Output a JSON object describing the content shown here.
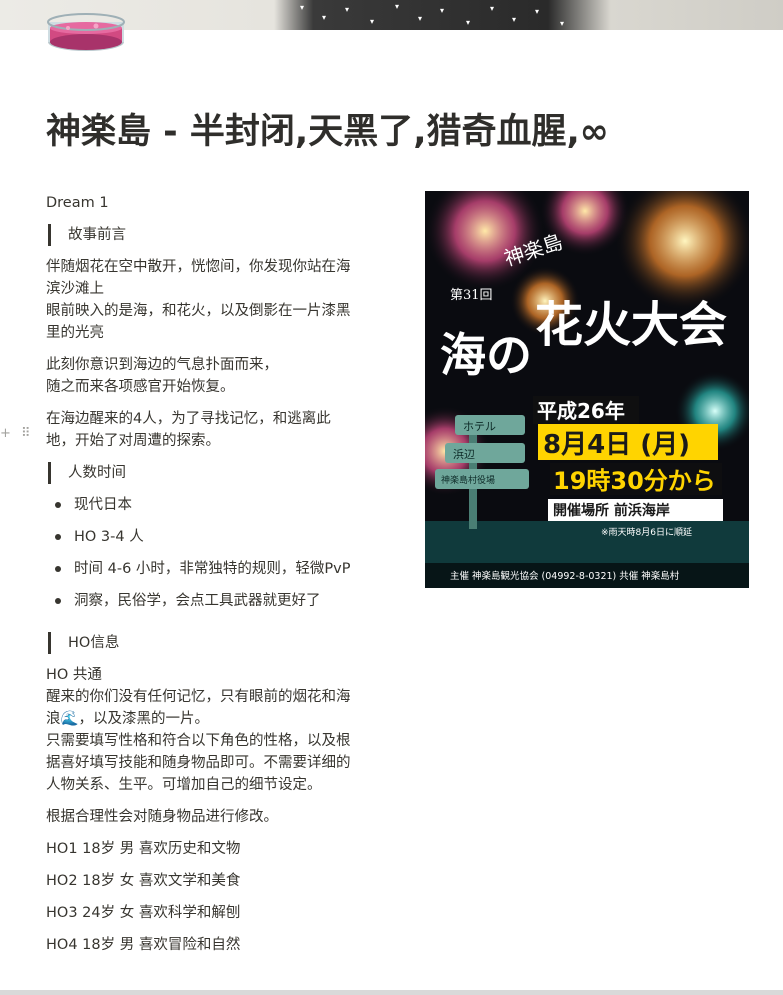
{
  "page": {
    "title": "神楽島 - 半封闭,天黑了,猎奇血腥,∞",
    "icon": "petri-dish-icon"
  },
  "cover": {
    "pattern": "cat-silhouettes"
  },
  "blocks": {
    "intro": "Dream 1",
    "section_story": "故事前言",
    "story_p1": [
      "伴随烟花在空中散开，恍惚间，你发现你站在海",
      "滨沙滩上",
      "眼前映入的是海，和花火，以及倒影在一片漆黑",
      "里的光亮"
    ],
    "story_p2": [
      "此刻你意识到海边的气息扑面而来，",
      "随之而来各项感官开始恢复。"
    ],
    "story_p3": [
      "在海边醒来的4人，为了寻找记忆，和逃离此",
      "地，开始了对周遭的探索。"
    ],
    "section_players": "人数时间",
    "bullets": [
      "现代日本",
      "HO 3-4 人",
      "时间 4-6 小时，非常独特的规则，轻微PvP",
      "洞察，民俗学，会点工具武器就更好了"
    ],
    "section_ho": "HO信息",
    "ho_common": [
      "HO 共通",
      "醒来的你们没有任何记忆，只有眼前的烟花和海",
      "浪🌊，以及漆黑的一片。",
      "只需要填写性格和符合以下角色的性格，以及根",
      "据喜好填写技能和随身物品即可。不需要详细的",
      "人物关系、生平。可增加自己的细节设定。"
    ],
    "ho_note": "根据合理性会对随身物品进行修改。",
    "ho_list": [
      "HO1 18岁 男 喜欢历史和文物",
      "HO2 18岁 女 喜欢文学和美食",
      "HO3 24岁 女 喜欢科学和解刨",
      "HO4 18岁 男 喜欢冒险和自然"
    ]
  },
  "poster": {
    "edition": "第31回",
    "place_name": "神楽島",
    "main_title_1": "海の",
    "main_title_2": "花火大会",
    "era_year": "平成26年",
    "date": "8月4日 (月)",
    "time": "19時30分から",
    "venue": "開催場所 前浜海岸",
    "rain_note": "※雨天時8月6日に順延",
    "sign_1": "ホテル",
    "sign_2": "浜辺",
    "sign_3": "神楽島村役場",
    "sponsor": "主催 神楽島観光協会 (04992-8-0321) 共催 神楽島村",
    "colors": {
      "bg": "#0a0b10",
      "yellow": "#ffd400",
      "pink": "#e8528f",
      "teal": "#2bb8b0"
    }
  }
}
